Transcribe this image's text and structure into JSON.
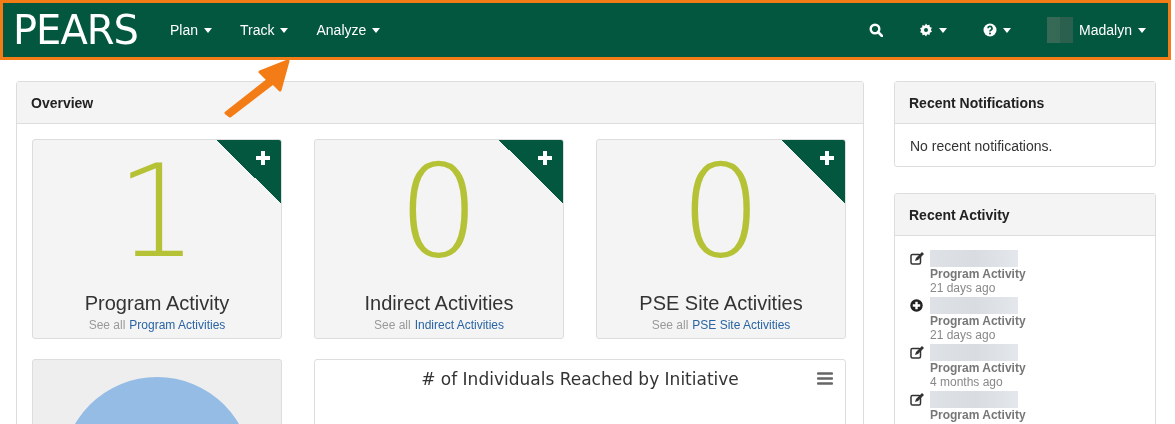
{
  "navbar": {
    "logo": "PEARS",
    "menus": [
      {
        "label": "Plan"
      },
      {
        "label": "Track"
      },
      {
        "label": "Analyze"
      }
    ],
    "user": "Madalyn"
  },
  "overview": {
    "title": "Overview",
    "tiles": [
      {
        "count": "1",
        "title": "Program Activity",
        "see_all": "See all",
        "link": "Program Activities"
      },
      {
        "count": "0",
        "title": "Indirect Activities",
        "see_all": "See all",
        "link": "Indirect Activities"
      },
      {
        "count": "0",
        "title": "PSE Site Activities",
        "see_all": "See all",
        "link": "PSE Site Activities"
      }
    ],
    "chart_title": "# of Individuals Reached by Initiative"
  },
  "notifications": {
    "title": "Recent Notifications",
    "message": "No recent notifications."
  },
  "activity": {
    "title": "Recent Activity",
    "items": [
      {
        "kind": "edit",
        "type": "Program Activity",
        "time": "21 days ago"
      },
      {
        "kind": "add",
        "type": "Program Activity",
        "time": "21 days ago"
      },
      {
        "kind": "edit",
        "type": "Program Activity",
        "time": "4 months ago"
      },
      {
        "kind": "edit",
        "type": "Program Activity"
      }
    ]
  }
}
